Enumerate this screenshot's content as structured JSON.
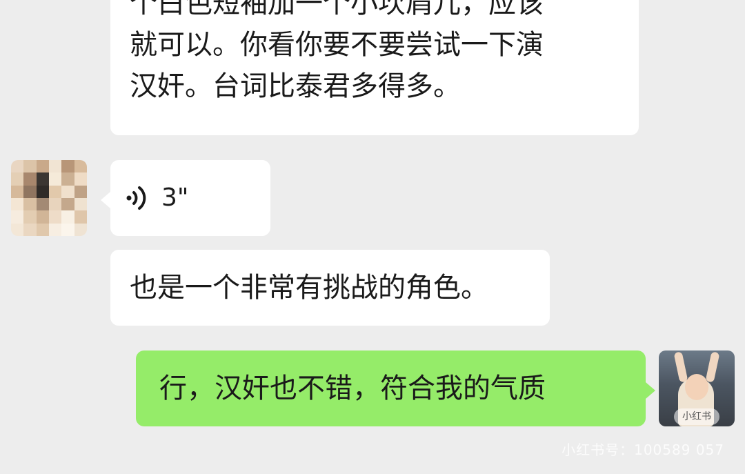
{
  "chat": {
    "messages": [
      {
        "side": "left",
        "type": "text",
        "lines": [
          "个白色短袖加一个小坎肩儿，应该",
          "就可以。你看你要不要尝试一下演",
          "汉奸。台词比泰君多得多。"
        ]
      },
      {
        "side": "left",
        "type": "voice",
        "duration": "3\""
      },
      {
        "side": "left",
        "type": "text",
        "text": "也是一个非常有挑战的角色。"
      },
      {
        "side": "right",
        "type": "text",
        "text": "行，汉奸也不错，符合我的气质"
      }
    ]
  },
  "avatars": {
    "self_badge": "小红书"
  },
  "watermark": "小红书号：100589 057",
  "colors": {
    "background": "#ededed",
    "incoming_bubble": "#ffffff",
    "outgoing_bubble": "#95ec69",
    "text": "#1a1a1a"
  }
}
